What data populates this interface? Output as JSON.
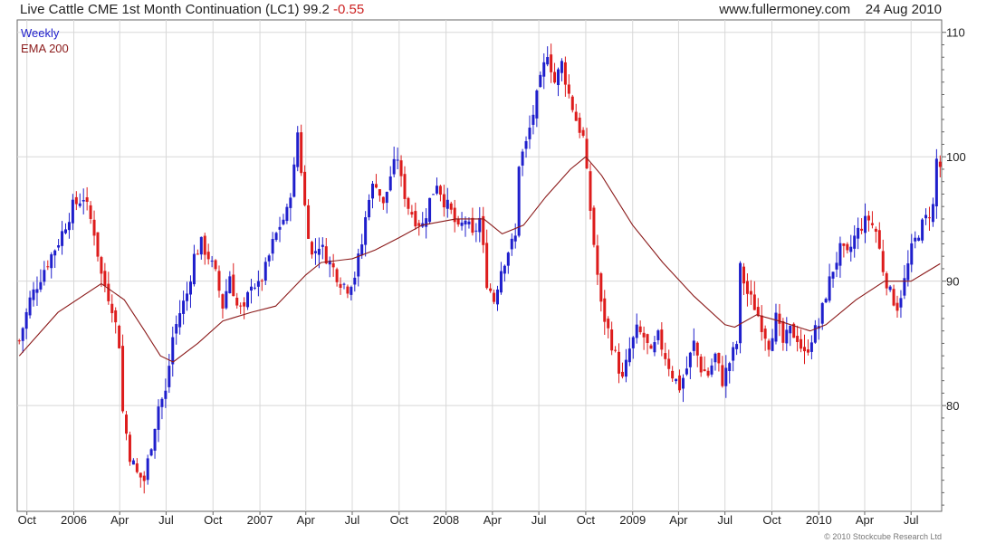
{
  "header": {
    "title": "Live Cattle CME 1st Month Continuation (LC1)",
    "last": "99.2",
    "change": "-0.55",
    "website": "www.fullermoney.com",
    "date": "24 Aug 2010"
  },
  "legend": {
    "interval": "Weekly",
    "ema_label": "EMA 200"
  },
  "copyright": "© 2010 Stockcube Research Ltd",
  "colors": {
    "up": "#1f1fcc",
    "down": "#dd1c1c",
    "ema": "#8b1a1a",
    "grid": "#d8d8d8",
    "axis": "#666666"
  },
  "chart_data": {
    "type": "candlestick",
    "interval": "Weekly",
    "series_names": [
      "Live Cattle CME 1st Month Continuation (LC1)",
      "EMA 200"
    ],
    "x_tick_labels": [
      "Oct",
      "2006",
      "Apr",
      "Jul",
      "Oct",
      "2007",
      "Apr",
      "Jul",
      "Oct",
      "2008",
      "Apr",
      "Jul",
      "Oct",
      "2009",
      "Apr",
      "Jul",
      "Oct",
      "2010",
      "Apr",
      "Jul"
    ],
    "x_tick_dates": [
      "2005-10-01",
      "2006-01-01",
      "2006-04-01",
      "2006-07-01",
      "2006-10-01",
      "2007-01-01",
      "2007-04-01",
      "2007-07-01",
      "2007-10-01",
      "2008-01-01",
      "2008-04-01",
      "2008-07-01",
      "2008-10-01",
      "2009-01-01",
      "2009-04-01",
      "2009-07-01",
      "2009-10-01",
      "2010-01-01",
      "2010-04-01",
      "2010-07-01"
    ],
    "x_range": [
      "2005-09-12",
      "2010-08-30"
    ],
    "y_ticks": [
      80,
      90,
      100,
      110
    ],
    "ylim": [
      71.5,
      111
    ],
    "grid": true,
    "y_axis_side": "right",
    "close_path": [
      [
        "2005-09-16",
        85.2
      ],
      [
        "2005-10-07",
        88.5
      ],
      [
        "2005-11-04",
        91.0
      ],
      [
        "2005-12-02",
        93.2
      ],
      [
        "2005-12-30",
        96.0
      ],
      [
        "2006-01-20",
        96.8
      ],
      [
        "2006-02-10",
        94.0
      ],
      [
        "2006-02-24",
        90.5
      ],
      [
        "2006-03-17",
        88.0
      ],
      [
        "2006-03-31",
        85.0
      ],
      [
        "2006-04-07",
        79.5
      ],
      [
        "2006-04-21",
        76.0
      ],
      [
        "2006-05-05",
        74.5
      ],
      [
        "2006-05-19",
        74.0
      ],
      [
        "2006-06-02",
        77.0
      ],
      [
        "2006-06-16",
        80.0
      ],
      [
        "2006-06-30",
        81.0
      ],
      [
        "2006-07-14",
        85.5
      ],
      [
        "2006-07-28",
        87.5
      ],
      [
        "2006-08-11",
        89.0
      ],
      [
        "2006-08-25",
        92.0
      ],
      [
        "2006-09-08",
        93.0
      ],
      [
        "2006-09-22",
        92.0
      ],
      [
        "2006-10-06",
        90.5
      ],
      [
        "2006-10-20",
        88.0
      ],
      [
        "2006-11-03",
        90.5
      ],
      [
        "2006-11-17",
        88.0
      ],
      [
        "2006-12-01",
        87.5
      ],
      [
        "2006-12-15",
        90.0
      ],
      [
        "2006-12-29",
        89.5
      ],
      [
        "2007-01-12",
        91.0
      ],
      [
        "2007-01-26",
        93.0
      ],
      [
        "2007-02-09",
        94.5
      ],
      [
        "2007-02-23",
        95.5
      ],
      [
        "2007-03-09",
        99.0
      ],
      [
        "2007-03-16",
        102.0
      ],
      [
        "2007-03-30",
        96.0
      ],
      [
        "2007-04-13",
        92.0
      ],
      [
        "2007-04-27",
        93.0
      ],
      [
        "2007-05-11",
        92.0
      ],
      [
        "2007-05-25",
        91.0
      ],
      [
        "2007-06-08",
        90.0
      ],
      [
        "2007-06-22",
        89.5
      ],
      [
        "2007-07-06",
        90.5
      ],
      [
        "2007-07-20",
        93.0
      ],
      [
        "2007-08-03",
        97.0
      ],
      [
        "2007-08-17",
        98.0
      ],
      [
        "2007-08-31",
        96.0
      ],
      [
        "2007-09-14",
        98.5
      ],
      [
        "2007-09-28",
        100.0
      ],
      [
        "2007-10-05",
        98.0
      ],
      [
        "2007-10-19",
        96.0
      ],
      [
        "2007-11-02",
        95.0
      ],
      [
        "2007-11-16",
        94.5
      ],
      [
        "2007-11-30",
        96.5
      ],
      [
        "2007-12-14",
        98.0
      ],
      [
        "2007-12-28",
        96.5
      ],
      [
        "2008-01-11",
        95.5
      ],
      [
        "2008-01-25",
        94.0
      ],
      [
        "2008-02-08",
        95.0
      ],
      [
        "2008-02-22",
        93.5
      ],
      [
        "2008-03-07",
        95.0
      ],
      [
        "2008-03-21",
        90.0
      ],
      [
        "2008-04-04",
        88.5
      ],
      [
        "2008-04-18",
        91.0
      ],
      [
        "2008-05-02",
        92.5
      ],
      [
        "2008-05-16",
        93.5
      ],
      [
        "2008-05-23",
        99.5
      ],
      [
        "2008-06-06",
        101.0
      ],
      [
        "2008-06-20",
        103.5
      ],
      [
        "2008-07-04",
        106.0
      ],
      [
        "2008-07-18",
        108.5
      ],
      [
        "2008-08-01",
        106.0
      ],
      [
        "2008-08-15",
        107.5
      ],
      [
        "2008-08-29",
        105.0
      ],
      [
        "2008-09-12",
        103.0
      ],
      [
        "2008-09-26",
        101.5
      ],
      [
        "2008-10-03",
        98.5
      ],
      [
        "2008-10-17",
        93.0
      ],
      [
        "2008-10-31",
        88.0
      ],
      [
        "2008-11-14",
        86.0
      ],
      [
        "2008-11-28",
        84.0
      ],
      [
        "2008-12-12",
        82.0
      ],
      [
        "2008-12-26",
        84.5
      ],
      [
        "2009-01-09",
        86.0
      ],
      [
        "2009-01-23",
        85.5
      ],
      [
        "2009-02-06",
        84.0
      ],
      [
        "2009-02-20",
        85.5
      ],
      [
        "2009-03-06",
        84.0
      ],
      [
        "2009-03-20",
        82.5
      ],
      [
        "2009-04-03",
        81.5
      ],
      [
        "2009-04-17",
        83.0
      ],
      [
        "2009-05-01",
        85.0
      ],
      [
        "2009-05-15",
        83.0
      ],
      [
        "2009-05-29",
        82.5
      ],
      [
        "2009-06-12",
        84.0
      ],
      [
        "2009-06-26",
        82.0
      ],
      [
        "2009-07-10",
        83.5
      ],
      [
        "2009-07-24",
        85.0
      ],
      [
        "2009-07-31",
        91.0
      ],
      [
        "2009-08-14",
        89.0
      ],
      [
        "2009-08-28",
        88.0
      ],
      [
        "2009-09-11",
        86.5
      ],
      [
        "2009-09-25",
        85.0
      ],
      [
        "2009-10-09",
        87.0
      ],
      [
        "2009-10-23",
        85.0
      ],
      [
        "2009-11-06",
        86.0
      ],
      [
        "2009-11-20",
        85.5
      ],
      [
        "2009-12-04",
        84.0
      ],
      [
        "2009-12-18",
        85.5
      ],
      [
        "2010-01-01",
        86.5
      ],
      [
        "2010-01-15",
        89.0
      ],
      [
        "2010-01-29",
        91.0
      ],
      [
        "2010-02-12",
        92.5
      ],
      [
        "2010-02-26",
        92.0
      ],
      [
        "2010-03-12",
        93.5
      ],
      [
        "2010-03-26",
        94.5
      ],
      [
        "2010-04-09",
        95.0
      ],
      [
        "2010-04-23",
        94.0
      ],
      [
        "2010-05-07",
        91.0
      ],
      [
        "2010-05-21",
        89.0
      ],
      [
        "2010-06-04",
        88.0
      ],
      [
        "2010-06-18",
        90.0
      ],
      [
        "2010-07-02",
        92.5
      ],
      [
        "2010-07-16",
        94.0
      ],
      [
        "2010-07-30",
        95.0
      ],
      [
        "2010-08-13",
        96.0
      ],
      [
        "2010-08-20",
        99.75
      ],
      [
        "2010-08-27",
        99.2
      ]
    ],
    "weekly_range_estimate": 1.8,
    "ema_200_path": [
      [
        "2005-09-16",
        84.0
      ],
      [
        "2005-12-01",
        87.5
      ],
      [
        "2006-02-24",
        89.8
      ],
      [
        "2006-04-10",
        88.5
      ],
      [
        "2006-05-20",
        86.0
      ],
      [
        "2006-06-20",
        84.0
      ],
      [
        "2006-07-15",
        83.5
      ],
      [
        "2006-09-01",
        85.0
      ],
      [
        "2006-10-20",
        86.8
      ],
      [
        "2006-12-15",
        87.5
      ],
      [
        "2007-02-01",
        88.0
      ],
      [
        "2007-04-01",
        90.5
      ],
      [
        "2007-05-01",
        91.5
      ],
      [
        "2007-07-01",
        91.8
      ],
      [
        "2007-08-15",
        92.5
      ],
      [
        "2007-10-01",
        93.5
      ],
      [
        "2007-11-15",
        94.5
      ],
      [
        "2008-01-20",
        95.0
      ],
      [
        "2008-03-15",
        95.0
      ],
      [
        "2008-04-20",
        93.8
      ],
      [
        "2008-06-01",
        94.5
      ],
      [
        "2008-07-15",
        96.8
      ],
      [
        "2008-09-01",
        99.0
      ],
      [
        "2008-10-01",
        100.0
      ],
      [
        "2008-11-01",
        98.5
      ],
      [
        "2009-01-01",
        94.5
      ],
      [
        "2009-03-01",
        91.5
      ],
      [
        "2009-05-01",
        88.8
      ],
      [
        "2009-07-01",
        86.5
      ],
      [
        "2009-07-20",
        86.3
      ],
      [
        "2009-09-01",
        87.3
      ],
      [
        "2009-10-15",
        86.8
      ],
      [
        "2009-12-15",
        86.0
      ],
      [
        "2010-01-15",
        86.5
      ],
      [
        "2010-03-15",
        88.5
      ],
      [
        "2010-05-10",
        90.0
      ],
      [
        "2010-07-01",
        90.0
      ],
      [
        "2010-08-27",
        91.4
      ]
    ]
  }
}
